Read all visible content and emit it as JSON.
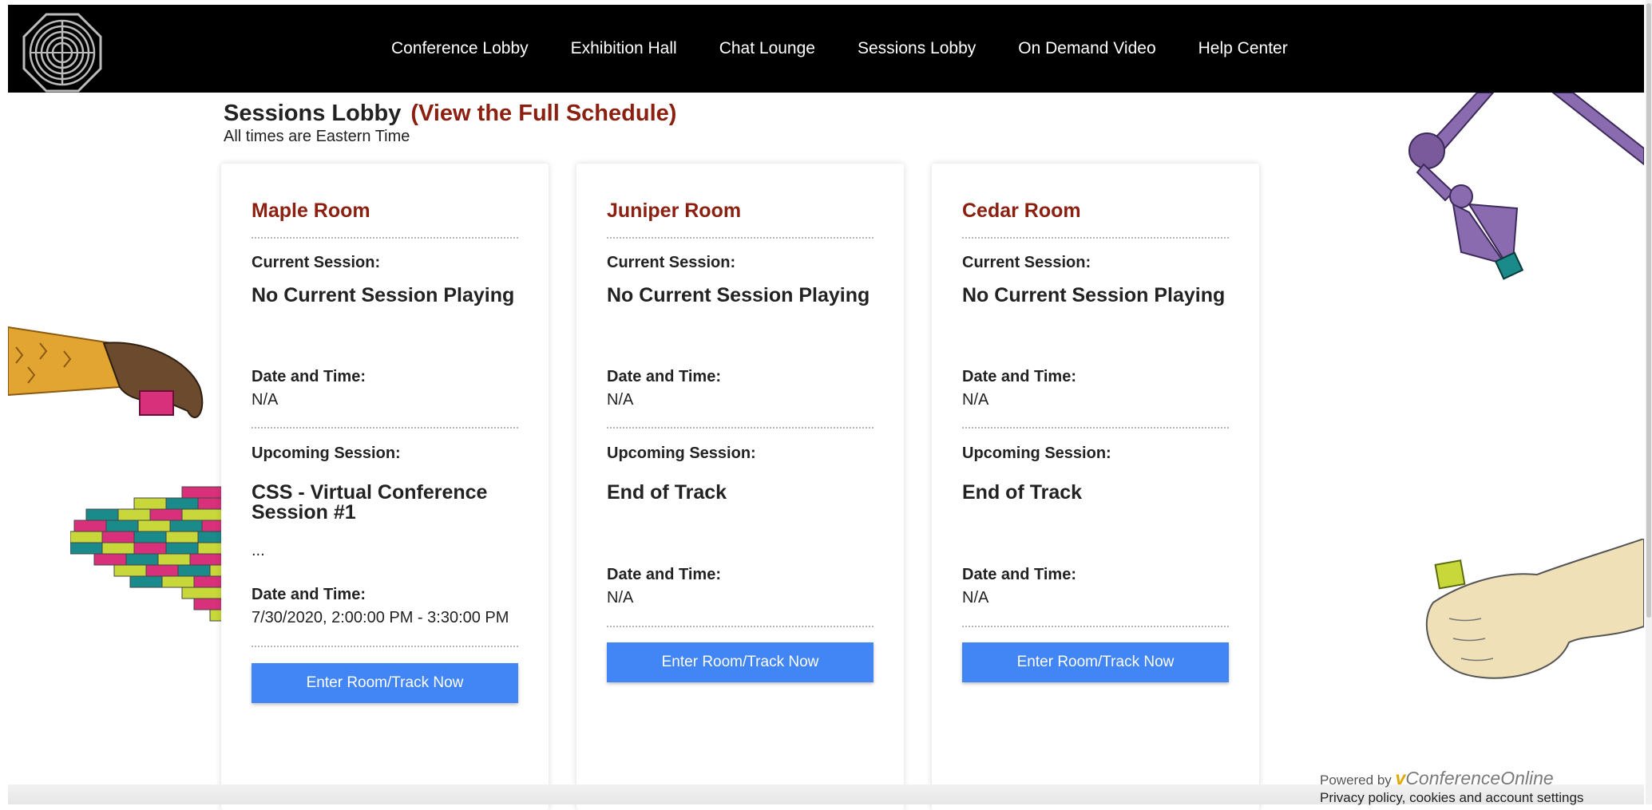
{
  "nav": {
    "items": [
      "Conference Lobby",
      "Exhibition Hall",
      "Chat Lounge",
      "Sessions Lobby",
      "On Demand Video",
      "Help Center"
    ]
  },
  "page": {
    "title": "Sessions Lobby",
    "schedule_link": "(View the Full Schedule)",
    "timezone_note": "All times are Eastern Time"
  },
  "rooms": [
    {
      "name": "Maple Room",
      "current_label": "Current Session:",
      "current_session": "No Current Session Playing",
      "current_dt_label": "Date and Time:",
      "current_dt": "N/A",
      "upcoming_label": "Upcoming Session:",
      "upcoming_session": "CSS - Virtual Conference Session #1",
      "upcoming_desc": "...",
      "upcoming_dt_label": "Date and Time:",
      "upcoming_dt": "7/30/2020, 2:00:00 PM - 3:30:00 PM",
      "button": "Enter Room/Track Now"
    },
    {
      "name": "Juniper Room",
      "current_label": "Current Session:",
      "current_session": "No Current Session Playing",
      "current_dt_label": "Date and Time:",
      "current_dt": "N/A",
      "upcoming_label": "Upcoming Session:",
      "upcoming_session": "End of Track",
      "upcoming_dt_label": "Date and Time:",
      "upcoming_dt": "N/A",
      "button": "Enter Room/Track Now"
    },
    {
      "name": "Cedar Room",
      "current_label": "Current Session:",
      "current_session": "No Current Session Playing",
      "current_dt_label": "Date and Time:",
      "current_dt": "N/A",
      "upcoming_label": "Upcoming Session:",
      "upcoming_session": "End of Track",
      "upcoming_dt_label": "Date and Time:",
      "upcoming_dt": "N/A",
      "button": "Enter Room/Track Now"
    }
  ],
  "footer": {
    "powered_by": "Powered by",
    "brand_v": "v",
    "brand_name": "ConferenceOnline",
    "privacy": "Privacy policy, cookies and account settings"
  },
  "colors": {
    "accent_red": "#8b1f10",
    "button_blue": "#4285f4",
    "header_bg": "#000000"
  }
}
